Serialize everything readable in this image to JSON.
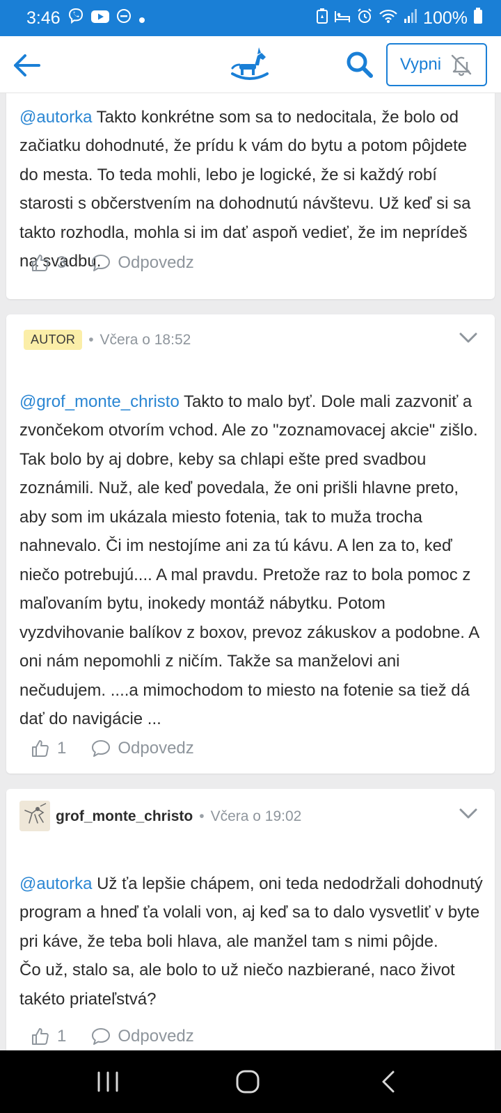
{
  "status_bar": {
    "time": "3:46",
    "battery": "100%",
    "left_icons": [
      "viber-icon",
      "youtube-icon",
      "dnd-icon",
      "dot-icon"
    ],
    "right_icons": [
      "battery-saver-icon",
      "sleep-icon",
      "alarm-icon",
      "wifi-icon",
      "signal-icon",
      "battery-icon"
    ]
  },
  "header": {
    "mute_label": "Vypni",
    "icons": [
      "back-arrow-icon",
      "rocking-horse-logo-icon",
      "search-icon",
      "bell-off-icon"
    ]
  },
  "comments": [
    {
      "mention": "@autorka",
      "text": " Takto konkrétne som sa to nedocitala, že bolo od začiatku dohodnuté, že prídu k vám do bytu a potom pôjdete do mesta. To teda mohli, lebo je logické, že si každý robí starosti s občerstvením na dohodnutú návštevu. Už keď si sa takto rozhodla, mohla si im dať aspoň vedieť, že im neprídeš na svadbu.",
      "likes": "3",
      "reply_label": "Odpovedz"
    },
    {
      "badge": "AUTOR",
      "time": "Včera o 18:52",
      "mention": "@grof_monte_christo",
      "text": " Takto to malo byť. Dole mali zazvoniť a zvončekom otvorím vchod. Ale zo \"zoznamovacej akcie\" zišlo. Tak bolo by aj dobre, keby sa chlapi ešte pred svadbou zoznámili. Nuž, ale keď povedala, že oni prišli hlavne preto, aby som im ukázala miesto fotenia, tak to muža trocha nahnevalo. Či im nestojíme ani za tú kávu. A len za to, keď niečo potrebujú.... A mal pravdu. Pretože raz to bola pomoc z maľovaním bytu, inokedy montáž nábytku. Potom vyzdvihovanie balíkov z boxov, prevoz zákuskov a podobne. A oni nám nepomohli z ničím. Takže sa manželovi ani nečudujem. ....a mimochodom to miesto na fotenie sa tiež dá dať do navigácie ...",
      "likes": "1",
      "reply_label": "Odpovedz"
    },
    {
      "username": "grof_monte_christo",
      "time": "Včera o 19:02",
      "mention": "@autorka",
      "text": " Už ťa lepšie chápem, oni teda nedodržali dohodnutý program a hneď ťa volali von, aj keď sa to dalo vysvetliť v byte pri káve, že teba boli hlava, ale manžel tam s nimi pôjde.\nČo už, stalo sa, ale bolo to už niečo nazbierané, naco život takéto priateľstvá?",
      "likes": "1",
      "reply_label": "Odpovedz"
    }
  ],
  "navbar": {
    "icons": [
      "recent-apps-icon",
      "home-icon",
      "back-icon"
    ]
  },
  "colors": {
    "accent": "#1a7fd6",
    "mention": "#2a86d3",
    "muted": "#8e959c",
    "badge_bg": "#fbeea8",
    "page_bg": "#ececed"
  }
}
